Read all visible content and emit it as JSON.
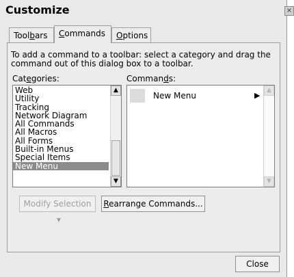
{
  "window": {
    "title": "Customize",
    "close_glyph": "×"
  },
  "tabs": [
    {
      "label": "Toolbars",
      "active": false
    },
    {
      "label": "Commands",
      "active": true
    },
    {
      "label": "Options",
      "active": false
    }
  ],
  "instructions": "To add a command to a toolbar: select a category and drag the command out of this dialog box to a toolbar.",
  "categories": {
    "label": "Categories:",
    "items": [
      "Web",
      "Utility",
      "Tracking",
      "Network Diagram",
      "All Commands",
      "All Macros",
      "All Forms",
      "Built-in Menus",
      "Special Items",
      "New Menu"
    ],
    "selected": "New Menu"
  },
  "commands": {
    "label": "Commands:",
    "items": [
      {
        "label": "New Menu",
        "submenu_glyph": "▶"
      }
    ]
  },
  "buttons": {
    "modify_selection": "Modify Selection",
    "rearrange": "Rearrange Commands...",
    "close": "Close"
  },
  "glyphs": {
    "up": "▲",
    "down": "▼",
    "dropdown": "▼"
  }
}
